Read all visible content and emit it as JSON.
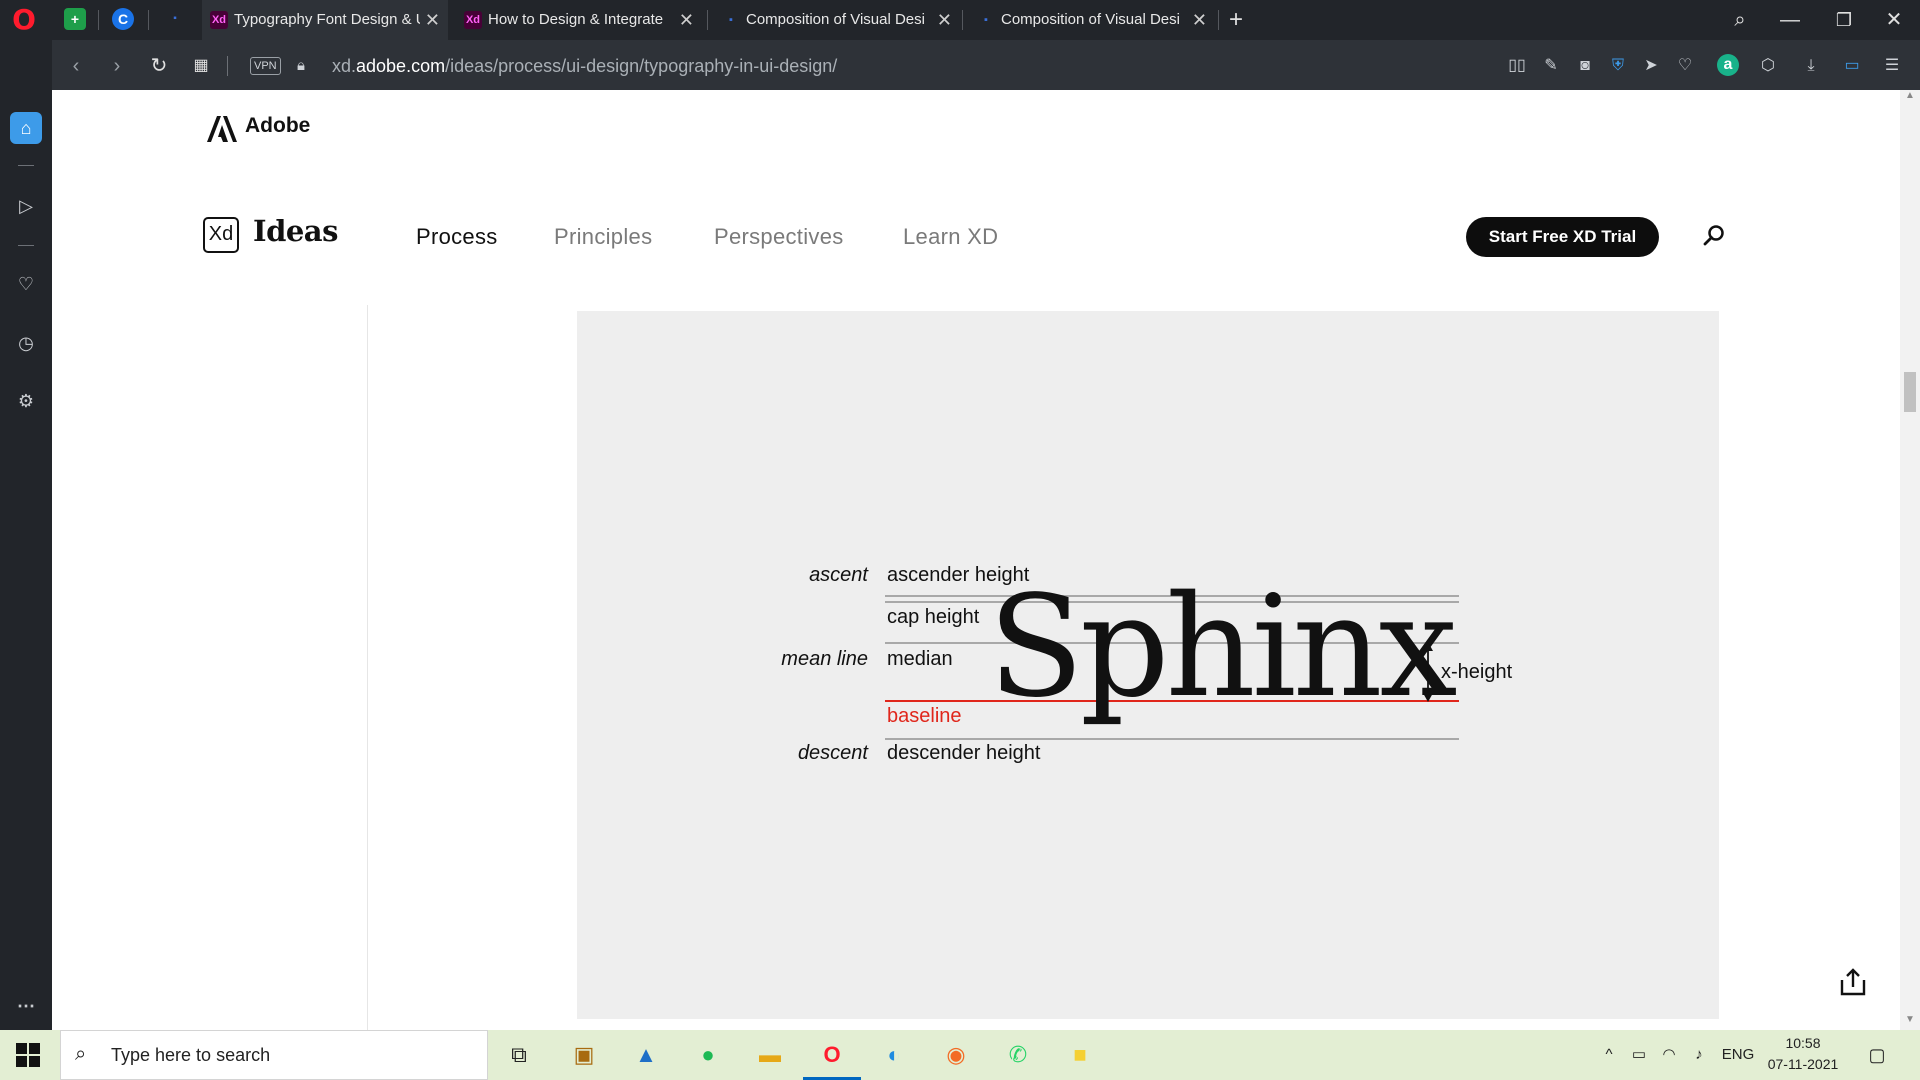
{
  "browser": {
    "tabs": [
      {
        "title": "Typography Font Design & UI",
        "favicon": "Xd",
        "active": true
      },
      {
        "title": "How to Design & Integrate",
        "favicon": "Xd",
        "active": false
      },
      {
        "title": "Composition of Visual Desi",
        "favicon": "doc",
        "active": false
      },
      {
        "title": "Composition of Visual Desi",
        "favicon": "doc",
        "active": false
      }
    ],
    "url_prefix": "xd.",
    "url_domain": "adobe.com",
    "url_path": "/ideas/process/ui-design/typography-in-ui-design/",
    "vpn_label": "VPN"
  },
  "site": {
    "brand": "Adobe",
    "product_badge": "Xd",
    "product_name": "Ideas",
    "nav": [
      "Process",
      "Principles",
      "Perspectives",
      "Learn XD"
    ],
    "active_nav": "Process",
    "cta": "Start Free XD Trial"
  },
  "figure": {
    "word": "Sphinx",
    "left_labels": {
      "ascent": "ascent",
      "mean_line": "mean line",
      "descent": "descent"
    },
    "line_labels": {
      "ascender": "ascender height",
      "cap": "cap height",
      "median": "median",
      "baseline": "baseline",
      "descender": "descender height"
    },
    "xheight_label": "x-height",
    "baseline_color": "#e0261b"
  },
  "taskbar": {
    "search_placeholder": "Type here to search",
    "language": "ENG",
    "time": "10:58",
    "date": "07-11-2021"
  },
  "colors": {
    "opera_red": "#ff1b2d",
    "chrome_dark": "#22252a",
    "taskbar_bg": "#e3eed3",
    "figure_bg": "#eeeeee"
  }
}
